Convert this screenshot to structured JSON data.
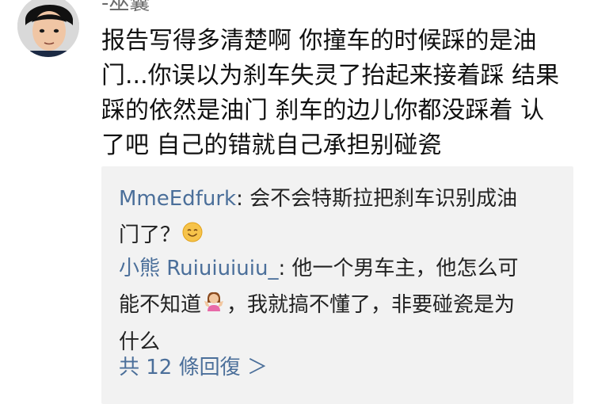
{
  "comment": {
    "author": "-巫囊",
    "avatar_icon": "user-avatar-photo",
    "text_lines": [
      "报告写得多清楚啊 你撞车的时候踩的是油",
      "门...你误以为刹车失灵了抬起来接着踩 结果",
      "踩的依然是油门 刹车的边儿你都没踩着 认",
      "了吧 自己的错就自己承担别碰瓷"
    ]
  },
  "replies": [
    {
      "name": "MmeEdfurk",
      "line1": ": 会不会特斯拉把刹车识别成油",
      "line2": "门了？",
      "emoji": "smiling-face-icon"
    },
    {
      "name": "小熊 Ruiuiuiuiu_",
      "line1": ": 他一个男车主，他怎么可",
      "line2a": "能不知道",
      "line2b": "，我就搞不懂了，非要碰瓷是为",
      "line3": "什么",
      "emoji": "person-shrugging-icon"
    }
  ],
  "more_link": {
    "label": "共 12 條回復",
    "icon": "chevron-right-icon",
    "chevron": "＞"
  },
  "colors": {
    "link": "#4b6f9a",
    "reply_background": "#f2f2f2",
    "author": "#6b6b6b"
  }
}
